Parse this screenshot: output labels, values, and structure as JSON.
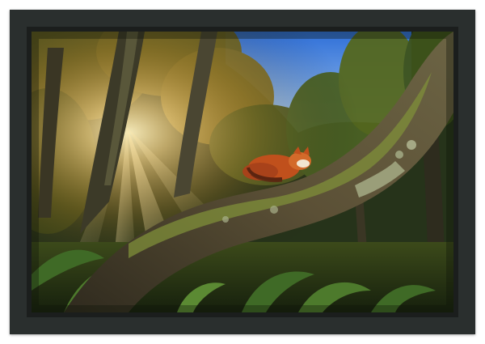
{
  "image": {
    "subject": "red-panda-sleeping-on-mossy-branch",
    "frame_color": "#2a2f2e",
    "mat_color": "#1b1e1d",
    "colors": {
      "sky_top": "#2f6fd8",
      "sky_bottom": "#a9cdf0",
      "forest_dark": "#1d2a12",
      "forest_mid": "#4a5a1e",
      "foliage_glow": "#c99a3a",
      "sunlight": "#ffd98a",
      "moss": "#7f8f3a",
      "branch_bark": "#4a4030",
      "panda_fur": "#c0501c",
      "panda_tail_ring": "#5b2410",
      "fern": "#3f6a26"
    }
  }
}
